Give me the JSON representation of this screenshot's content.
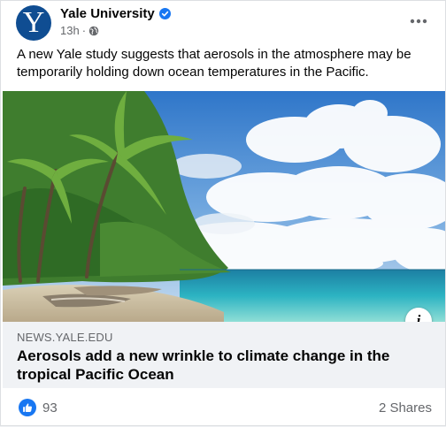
{
  "post": {
    "page_name": "Yale University",
    "verified_icon": "verified-badge-icon",
    "time": "13h",
    "separator": "·",
    "audience_icon": "globe-icon",
    "avatar_letter": "Y",
    "text": "A new Yale study suggests that aerosols in the atmosphere may be temporarily holding down ocean temperatures in the Pacific."
  },
  "link": {
    "domain": "NEWS.YALE.EDU",
    "title": "Aerosols add a new wrinkle to climate change in the tropical Pacific Ocean",
    "info_label": "i"
  },
  "engagement": {
    "like_count": "93",
    "shares": "2 Shares"
  },
  "colors": {
    "brand_avatar": "#0f4d92",
    "facebook_blue": "#1877f2",
    "secondary_text": "#65676b",
    "link_box_bg": "#f0f2f5"
  }
}
